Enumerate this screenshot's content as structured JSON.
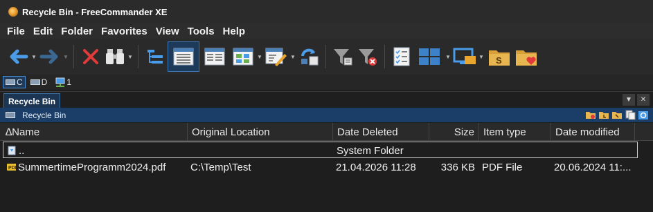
{
  "window": {
    "title": "Recycle Bin - FreeCommander XE"
  },
  "menu": [
    "File",
    "Edit",
    "Folder",
    "Favorites",
    "View",
    "Tools",
    "Help"
  ],
  "toolbar": {
    "buttons": [
      {
        "name": "back",
        "icon": "arrow-left-icon"
      },
      {
        "name": "forward",
        "icon": "arrow-right-icon"
      },
      {
        "name": "delete",
        "icon": "red-x-icon"
      },
      {
        "name": "find",
        "icon": "binoculars-icon"
      },
      {
        "name": "tree-view",
        "icon": "tree-icon"
      },
      {
        "name": "details-view",
        "icon": "details-list-icon"
      },
      {
        "name": "list-view",
        "icon": "list-icon"
      },
      {
        "name": "thumbnails-view",
        "icon": "thumbnails-icon"
      },
      {
        "name": "quick-view",
        "icon": "edit-window-icon"
      },
      {
        "name": "sync",
        "icon": "sync-icon"
      },
      {
        "name": "filter",
        "icon": "filter-icon"
      },
      {
        "name": "clear-filter",
        "icon": "filter-clear-icon"
      },
      {
        "name": "checklist",
        "icon": "checklist-icon"
      },
      {
        "name": "layout",
        "icon": "grid-layout-icon"
      },
      {
        "name": "monitor",
        "icon": "monitor-icon"
      },
      {
        "name": "favorite-folder",
        "icon": "folder-s-icon"
      },
      {
        "name": "folder-heart",
        "icon": "folder-heart-icon"
      }
    ]
  },
  "drives": [
    {
      "label": "C",
      "selected": true
    },
    {
      "label": "D",
      "selected": false
    },
    {
      "label": "1",
      "selected": false
    }
  ],
  "tab": {
    "label": "Recycle Bin"
  },
  "path": {
    "label": "Recycle Bin"
  },
  "columns": {
    "name": "∆Name",
    "original_location": "Original Location",
    "date_deleted": "Date Deleted",
    "size": "Size",
    "item_type": "Item type",
    "date_modified": "Date modified"
  },
  "rows": [
    {
      "name": "..",
      "original_location": "",
      "date_deleted": "System Folder",
      "size": "",
      "item_type": "",
      "date_modified": ""
    },
    {
      "name": "SummertimeProgramm2024.pdf",
      "original_location": "C:\\Temp\\Test",
      "date_deleted": "21.04.2026 11:28",
      "size": "336 KB",
      "item_type": "PDF File",
      "date_modified": "20.06.2024 11:..."
    }
  ],
  "colors": {
    "accent_blue": "#1a3e68",
    "delete_red": "#e03a3a",
    "icon_blue": "#4a9be8"
  }
}
